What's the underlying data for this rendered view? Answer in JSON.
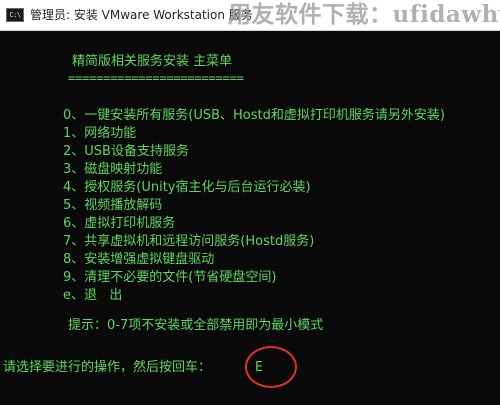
{
  "window": {
    "title": "管理员: 安装 VMware Workstation 服务",
    "watermark": "用友软件下载：ufidawhy.com"
  },
  "menu": {
    "heading": "精简版相关服务安装 主菜单",
    "divider": "=========================",
    "items": [
      "0、一键安装所有服务(USB、Hostd和虚拟打印机服务请另外安装)",
      "1、网络功能",
      "2、USB设备支持服务",
      "3、磁盘映射功能",
      "4、授权服务(Unity宿主化与后台运行必装)",
      "5、视频播放解码",
      "6、虚拟打印机服务",
      "7、共享虚拟机和远程访问服务(Hostd服务)",
      "8、安装增强虚拟键盘驱动",
      "9、清理不必要的文件(节省硬盘空间)",
      "e、退   出"
    ],
    "hint": "提示：0-7项不安装或全部禁用即为最小模式"
  },
  "prompt": {
    "label": "请选择要进行的操作，然后按回车：",
    "value": "E"
  },
  "colors": {
    "console_bg": "#0a0a0a",
    "console_text": "#5fd55f",
    "highlight": "#e03030"
  }
}
